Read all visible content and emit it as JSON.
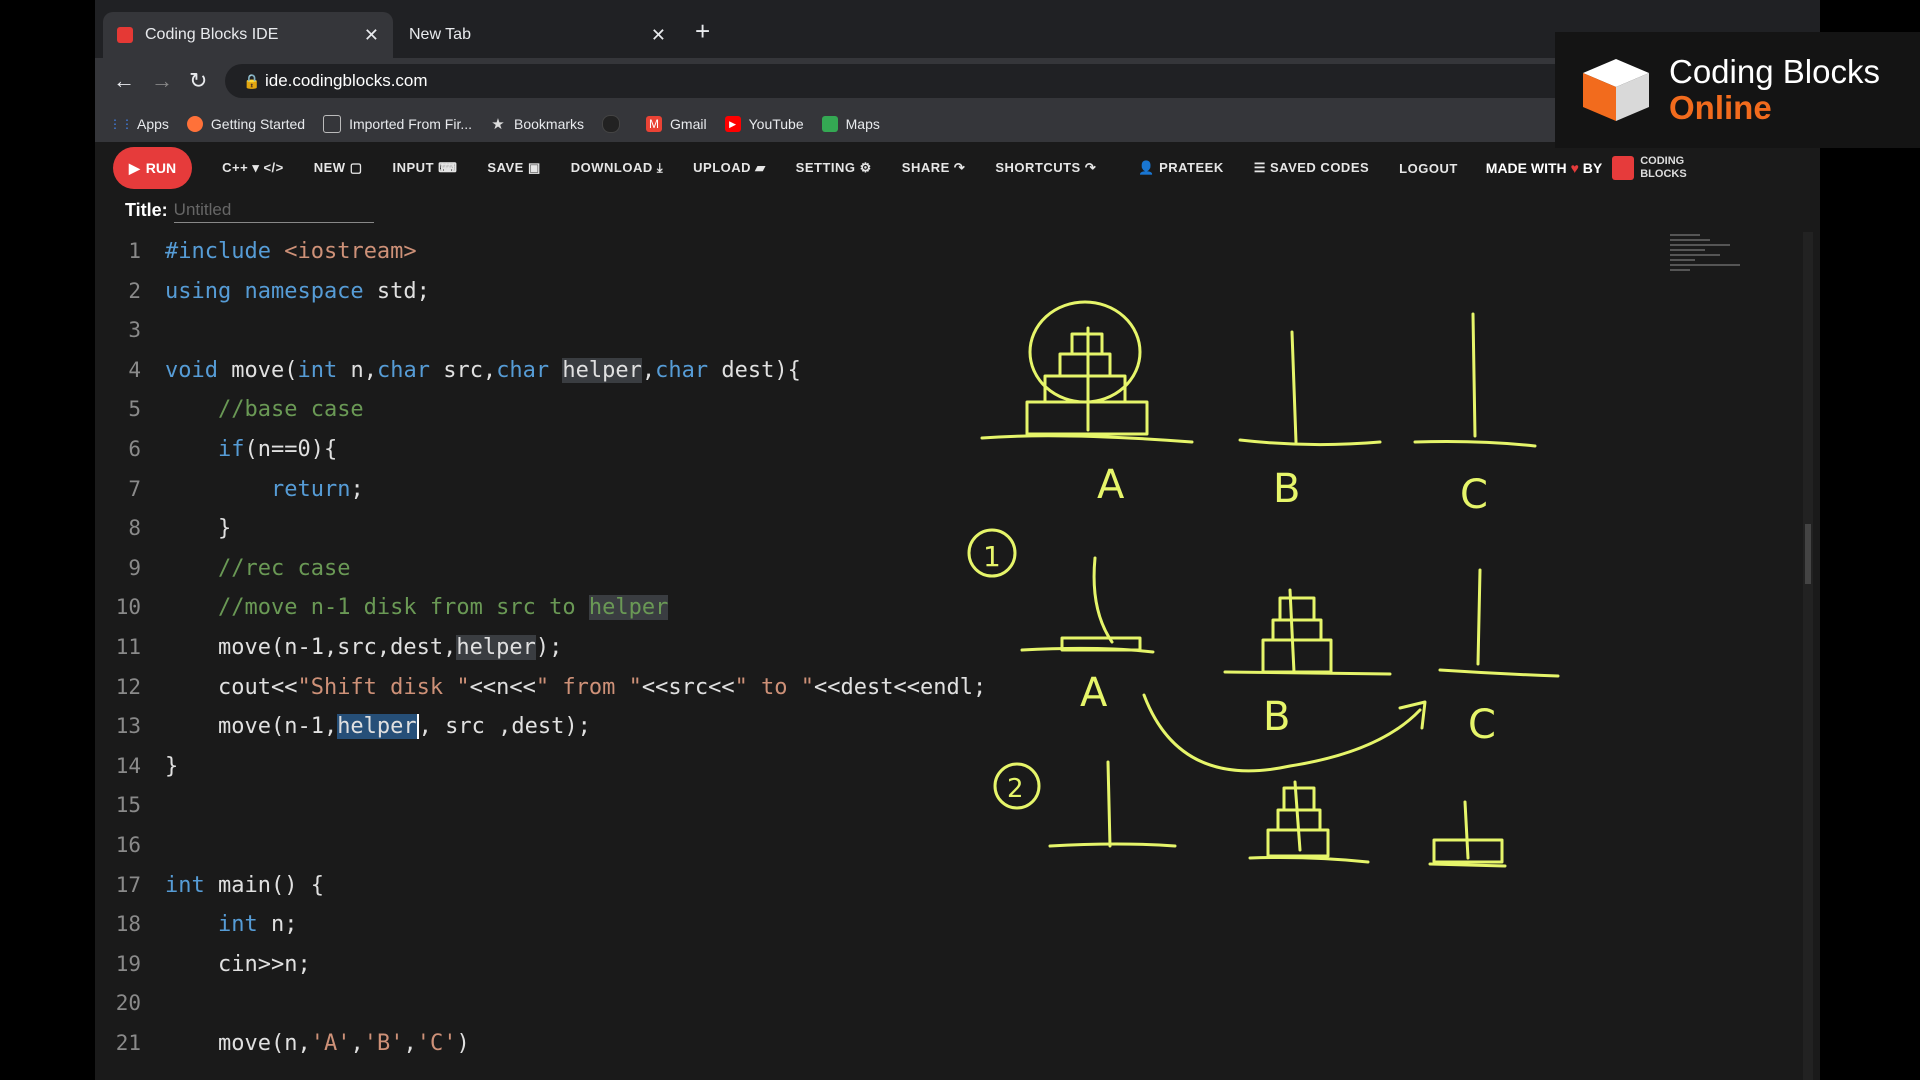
{
  "browser": {
    "tabs": [
      {
        "label": "Coding Blocks IDE",
        "active": true
      },
      {
        "label": "New Tab",
        "active": false
      }
    ],
    "url": "ide.codingblocks.com",
    "bookmarks": [
      "Apps",
      "Getting Started",
      "Imported From Fir...",
      "Bookmarks",
      "Gmail",
      "YouTube",
      "Maps"
    ]
  },
  "toolbar": {
    "run": "RUN",
    "language": "C++",
    "items": [
      "NEW",
      "INPUT",
      "SAVE",
      "DOWNLOAD",
      "UPLOAD",
      "SETTING",
      "SHARE",
      "SHORTCUTS"
    ],
    "user": "PRATEEK",
    "saved": "SAVED CODES",
    "logout": "LOGOUT",
    "made_with": "MADE WITH",
    "by": "BY",
    "logo_line1": "CODING",
    "logo_line2": "BLOCKS"
  },
  "title": {
    "label": "Title:",
    "placeholder": "Untitled"
  },
  "editor": {
    "line_numbers": [
      "1",
      "2",
      "3",
      "4",
      "5",
      "6",
      "7",
      "8",
      "9",
      "10",
      "11",
      "12",
      "13",
      "14",
      "15",
      "16",
      "17",
      "18",
      "19",
      "20",
      "21"
    ]
  },
  "drawing": {
    "labels": [
      "A",
      "B",
      "C",
      "A",
      "B",
      "C"
    ],
    "steps": [
      "1",
      "2"
    ]
  },
  "watermark": {
    "line1": "Coding Blocks",
    "line2": "Online"
  },
  "colors": {
    "run": "#e63b3b",
    "keyword": "#569cd6",
    "comment": "#6a9955",
    "string": "#ce9178",
    "sketch": "#e6f56a",
    "brand_orange": "#f26b1d"
  }
}
